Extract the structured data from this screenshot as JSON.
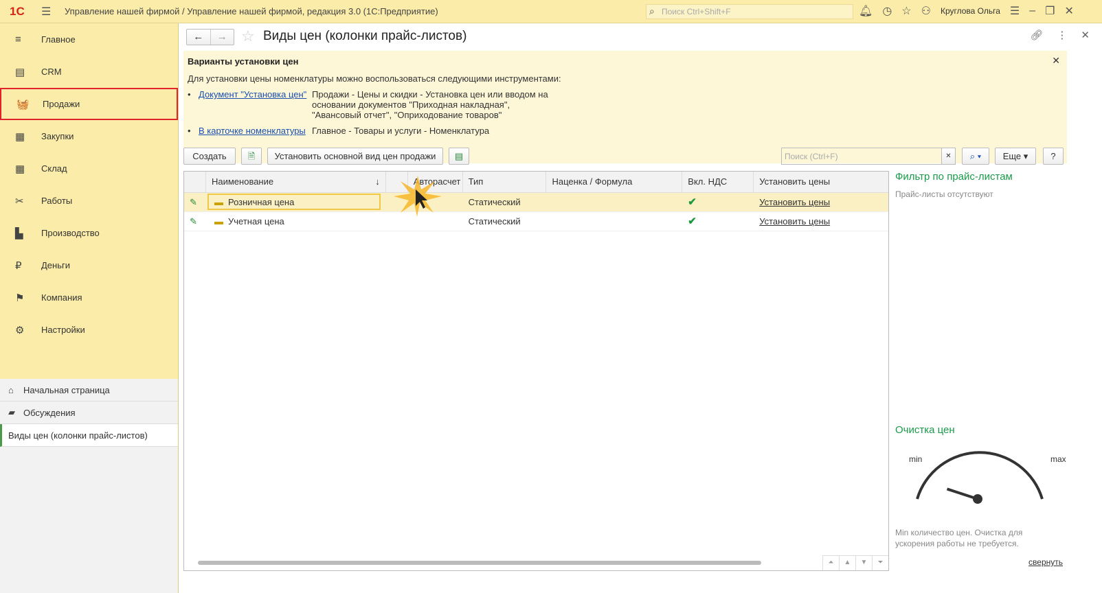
{
  "app": {
    "logo": "1С",
    "title": "Управление нашей фирмой / Управление нашей фирмой, редакция 3.0  (1С:Предприятие)",
    "search_placeholder": "Поиск Ctrl+Shift+F",
    "user": "Круглова Ольга"
  },
  "sidebar": {
    "items": [
      {
        "label": "Главное",
        "icon": "≡"
      },
      {
        "label": "CRM",
        "icon": "▤"
      },
      {
        "label": "Продажи",
        "icon": "🧺"
      },
      {
        "label": "Закупки",
        "icon": "▦"
      },
      {
        "label": "Склад",
        "icon": "▦"
      },
      {
        "label": "Работы",
        "icon": "✂"
      },
      {
        "label": "Производство",
        "icon": "▙"
      },
      {
        "label": "Деньги",
        "icon": "₽"
      },
      {
        "label": "Компания",
        "icon": "⚑"
      },
      {
        "label": "Настройки",
        "icon": "⚙"
      }
    ],
    "links": [
      {
        "label": "Начальная страница",
        "icon": "⌂"
      },
      {
        "label": "Обсуждения",
        "icon": "💬"
      },
      {
        "label": "Виды цен (колонки прайс-листов)"
      }
    ]
  },
  "page": {
    "title": "Виды цен (колонки прайс-листов)"
  },
  "info": {
    "heading": "Варианты установки цен",
    "intro": "Для установки цены номенклатуры можно воспользоваться следующими инструментами:",
    "items": [
      {
        "link": "Документ \"Установка цен\"",
        "text": "Продажи - Цены и скидки - Установка цен или вводом на основании документов \"Приходная накладная\", \"Авансовый отчет\", \"Оприходование товаров\""
      },
      {
        "link": "В карточке номенклатуры",
        "text": "Главное - Товары и услуги - Номенклатура"
      }
    ]
  },
  "toolbar": {
    "create": "Создать",
    "set_main": "Установить основной вид цен продажи",
    "search_placeholder": "Поиск (Ctrl+F)",
    "more": "Еще",
    "help": "?"
  },
  "table": {
    "columns": [
      "Наименование",
      "Авторасчет",
      "Тип",
      "Наценка / Формула",
      "Вкл. НДС",
      "Установить цены"
    ],
    "rows": [
      {
        "name": "Розничная цена",
        "auto": "",
        "type": "Статический",
        "markup": "",
        "vat": "✔",
        "action": "Установить цены"
      },
      {
        "name": "Учетная цена",
        "auto": "",
        "type": "Статический",
        "markup": "",
        "vat": "✔",
        "action": "Установить цены"
      }
    ]
  },
  "filter": {
    "title": "Фильтр по прайс-листам",
    "empty": "Прайс-листы отсутствуют"
  },
  "cleanup": {
    "title": "Очистка цен",
    "min": "min",
    "max": "max",
    "gauge_value": 0.2,
    "text": "Min количество цен. Очистка для ускорения работы не требуется.",
    "collapse": "свернуть"
  }
}
